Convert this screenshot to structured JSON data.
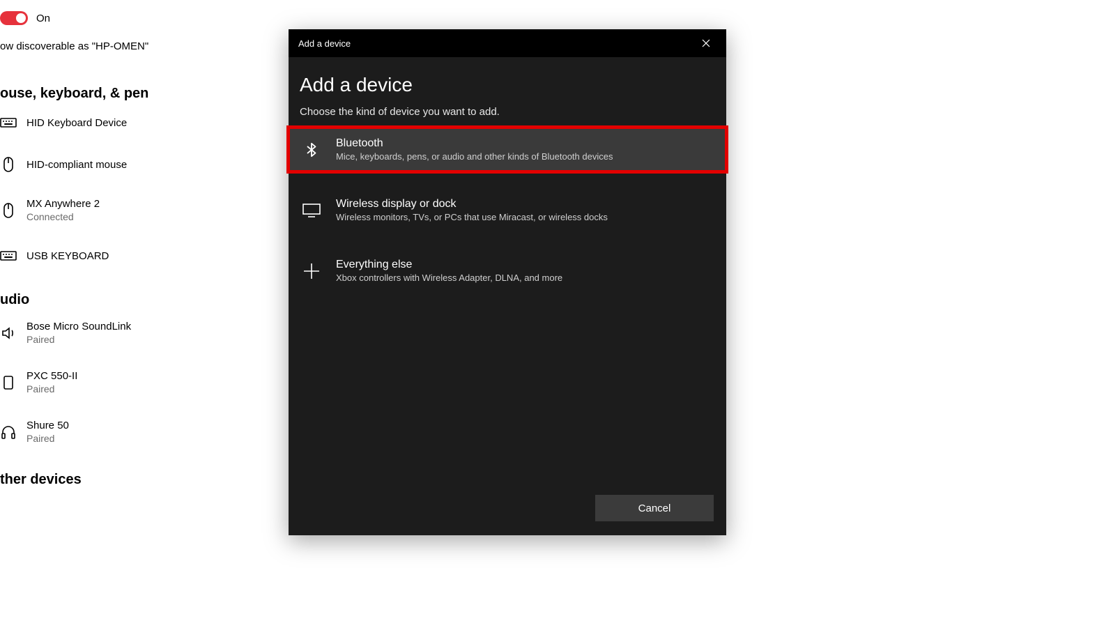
{
  "background": {
    "toggle_label": "On",
    "discoverable_text": "ow discoverable as \"HP-OMEN\"",
    "section_mouse_head": "ouse, keyboard, & pen",
    "section_audio_head": "udio",
    "section_other_head": "ther devices",
    "devices_mouse": [
      {
        "name": "HID Keyboard Device",
        "status": "",
        "icon": "keyboard-icon"
      },
      {
        "name": "HID-compliant mouse",
        "status": "",
        "icon": "mouse-icon"
      },
      {
        "name": "MX Anywhere 2",
        "status": "Connected",
        "icon": "mouse-icon"
      },
      {
        "name": "USB KEYBOARD",
        "status": "",
        "icon": "keyboard-icon"
      }
    ],
    "devices_audio": [
      {
        "name": "Bose Micro SoundLink",
        "status": "Paired",
        "icon": "speaker-icon"
      },
      {
        "name": "PXC 550-II",
        "status": "Paired",
        "icon": "device-icon"
      },
      {
        "name": "Shure 50",
        "status": "Paired",
        "icon": "headphone-icon"
      }
    ]
  },
  "modal": {
    "titlebar": "Add a device",
    "heading": "Add a device",
    "subhead": "Choose the kind of device you want to add.",
    "choices": [
      {
        "title": "Bluetooth",
        "desc": "Mice, keyboards, pens, or audio and other kinds of Bluetooth devices",
        "icon": "bluetooth-icon",
        "highlight": true
      },
      {
        "title": "Wireless display or dock",
        "desc": "Wireless monitors, TVs, or PCs that use Miracast, or wireless docks",
        "icon": "display-icon",
        "highlight": false
      },
      {
        "title": "Everything else",
        "desc": "Xbox controllers with Wireless Adapter, DLNA, and more",
        "icon": "plus-icon",
        "highlight": false
      }
    ],
    "cancel_label": "Cancel"
  }
}
